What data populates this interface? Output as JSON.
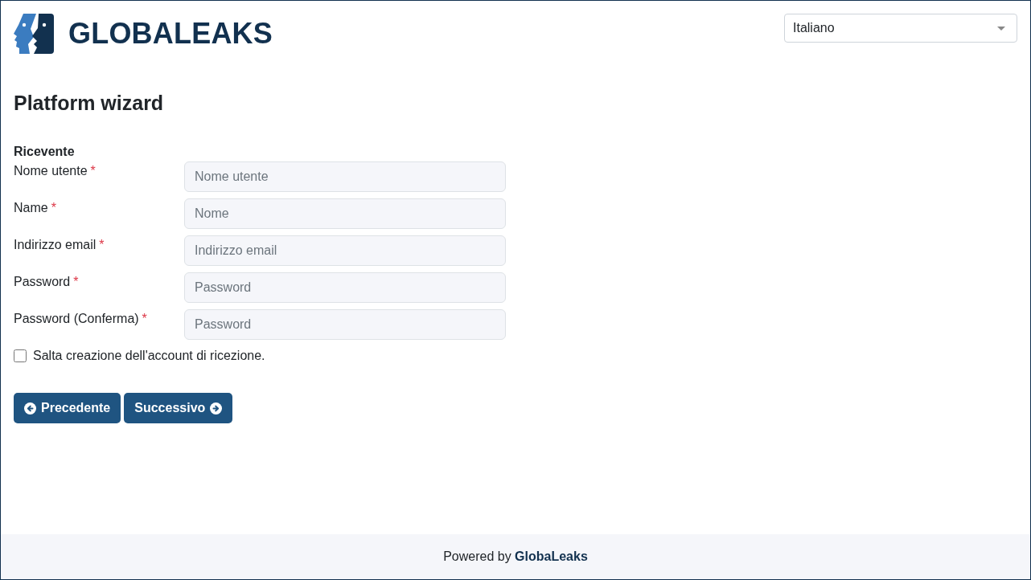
{
  "header": {
    "brand": "GLOBALEAKS",
    "language_select": {
      "value": "Italiano"
    }
  },
  "page_title": "Platform wizard",
  "section_title": "Ricevente",
  "fields": [
    {
      "label": "Nome utente",
      "required_mark": "*",
      "placeholder": "Nome utente"
    },
    {
      "label": "Name",
      "required_mark": "*",
      "placeholder": "Nome"
    },
    {
      "label": "Indirizzo email",
      "required_mark": "*",
      "placeholder": "Indirizzo email"
    },
    {
      "label": "Password",
      "required_mark": "*",
      "placeholder": "Password"
    },
    {
      "label": "Password (Conferma)",
      "required_mark": "*",
      "placeholder": "Password"
    }
  ],
  "skip_option": {
    "label": "Salta creazione dell'account di ricezione.",
    "checked": false
  },
  "buttons": [
    {
      "label": "Precedente",
      "kind": "previous"
    },
    {
      "label": "Successivo",
      "kind": "next"
    }
  ],
  "footer": {
    "text": "Powered by **GlobaLeaks**"
  }
}
